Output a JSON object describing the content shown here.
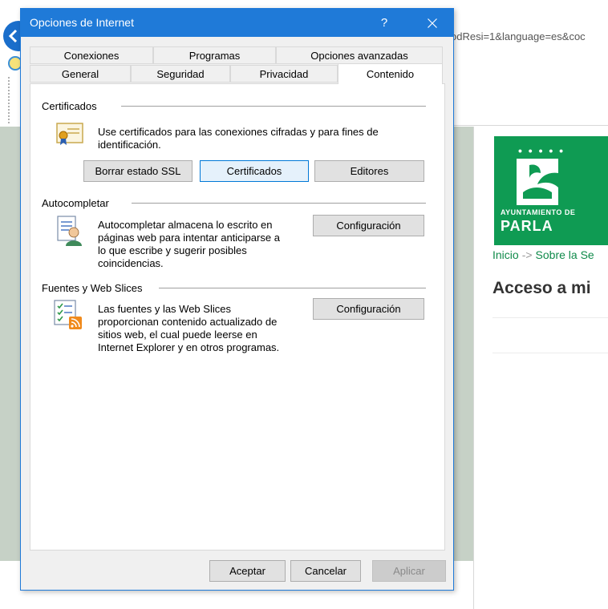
{
  "browser": {
    "url_fragment": "odResi=1&language=es&coc",
    "breadcrumb_home": "Inicio",
    "breadcrumb_sep": "->",
    "breadcrumb_next": "Sobre la Se",
    "page_heading": "Acceso a mi",
    "logo_subtext": "AYUNTAMIENTO DE",
    "logo_name": "PARLA"
  },
  "dialog": {
    "title": "Opciones de Internet",
    "help_label": "?",
    "close_icon": "close-icon",
    "tabs_row1": [
      "Conexiones",
      "Programas",
      "Opciones avanzadas"
    ],
    "tabs_row2": [
      "General",
      "Seguridad",
      "Privacidad",
      "Contenido"
    ],
    "active_tab": "Contenido",
    "certificates": {
      "label": "Certificados",
      "lines": [
        "Use certificados para las conexiones cifradas y para fines de",
        "identificación."
      ],
      "buttons": [
        "Borrar estado SSL",
        "Certificados",
        "Editores"
      ],
      "icon": "certificate-icon"
    },
    "autocomplete": {
      "label": "Autocompletar",
      "lines": [
        "Autocompletar almacena lo escrito en",
        "páginas web para intentar anticiparse a",
        "lo que escribe y sugerir posibles",
        "coincidencias."
      ],
      "button": "Configuración",
      "icon": "autocomplete-user-icon"
    },
    "feeds": {
      "label": "Fuentes y Web Slices",
      "lines": [
        "Las fuentes y las Web Slices",
        "proporcionan contenido actualizado de",
        "sitios web, el cual puede leerse en",
        "Internet Explorer y en otros programas."
      ],
      "button": "Configuración",
      "icon": "feeds-rss-icon"
    },
    "footer_buttons": {
      "ok": "Aceptar",
      "cancel": "Cancelar",
      "apply": "Aplicar"
    },
    "colors": {
      "titlebar": "#1f7ad8",
      "logo_green": "#0f9b53"
    }
  }
}
